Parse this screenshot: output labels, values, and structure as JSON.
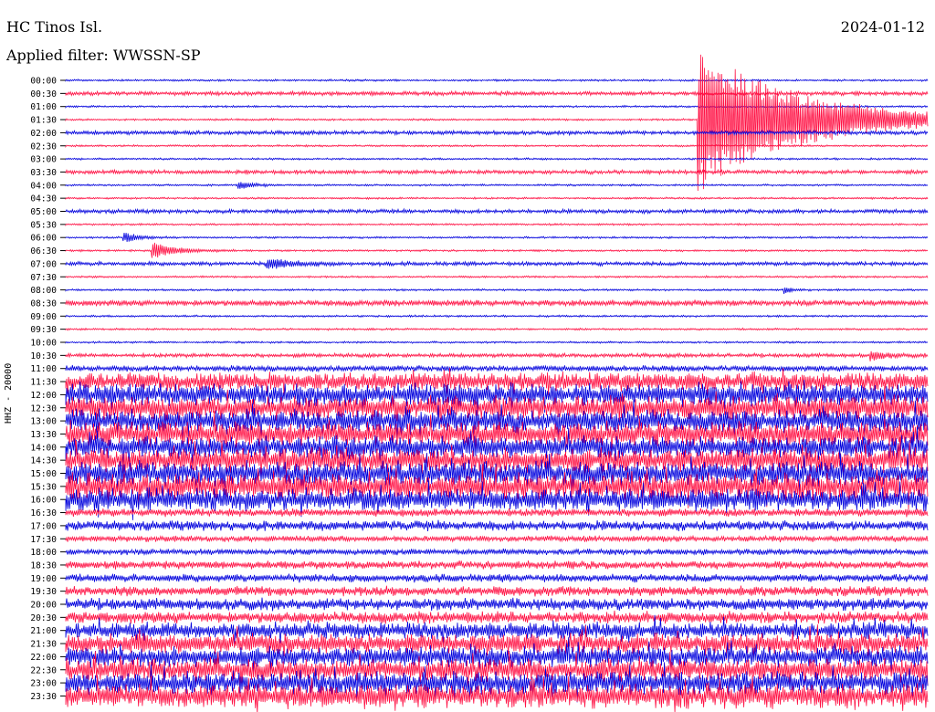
{
  "header": {
    "station": "HC Tinos Isl.",
    "date": "2024-01-12",
    "filter": "Applied filter: WWSSN-SP"
  },
  "chart_data": {
    "type": "line",
    "title": "HC Tinos Isl.",
    "ylabel": "HHZ - 20000",
    "row_labels": [
      "00:00",
      "00:30",
      "01:00",
      "01:30",
      "02:00",
      "02:30",
      "03:00",
      "03:30",
      "04:00",
      "04:30",
      "05:00",
      "05:30",
      "06:00",
      "06:30",
      "07:00",
      "07:30",
      "08:00",
      "08:30",
      "09:00",
      "09:30",
      "10:00",
      "10:30",
      "11:00",
      "11:30",
      "12:00",
      "12:30",
      "13:00",
      "13:30",
      "14:00",
      "14:30",
      "15:00",
      "15:30",
      "16:00",
      "16:30",
      "17:00",
      "17:30",
      "18:00",
      "18:30",
      "19:00",
      "19:30",
      "20:00",
      "20:30",
      "21:00",
      "21:30",
      "22:00",
      "22:30",
      "23:00",
      "23:30"
    ],
    "series_colors": [
      "#0000dd",
      "#ff1144"
    ],
    "noise_level": [
      1,
      2,
      1,
      1,
      2,
      1,
      1,
      2,
      1,
      1,
      2,
      1,
      1,
      1,
      2,
      1,
      1,
      3,
      1,
      1,
      1,
      2,
      3,
      9,
      11,
      12,
      11,
      12,
      11,
      12,
      12,
      13,
      11,
      4,
      5,
      3,
      3,
      4,
      4,
      5,
      6,
      6,
      8,
      10,
      10,
      11,
      11,
      12
    ],
    "events": [
      {
        "row": 3,
        "minute": 22,
        "amplitude": 80,
        "duration_min": 14
      },
      {
        "row": 12,
        "minute": 2,
        "amplitude": 6,
        "duration_min": 2
      },
      {
        "row": 13,
        "minute": 3,
        "amplitude": 10,
        "duration_min": 3
      },
      {
        "row": 14,
        "minute": 7,
        "amplitude": 6,
        "duration_min": 3
      },
      {
        "row": 8,
        "minute": 6,
        "amplitude": 4,
        "duration_min": 2
      },
      {
        "row": 16,
        "minute": 25,
        "amplitude": 4,
        "duration_min": 1
      },
      {
        "row": 21,
        "minute": 28,
        "amplitude": 5,
        "duration_min": 2
      }
    ]
  }
}
